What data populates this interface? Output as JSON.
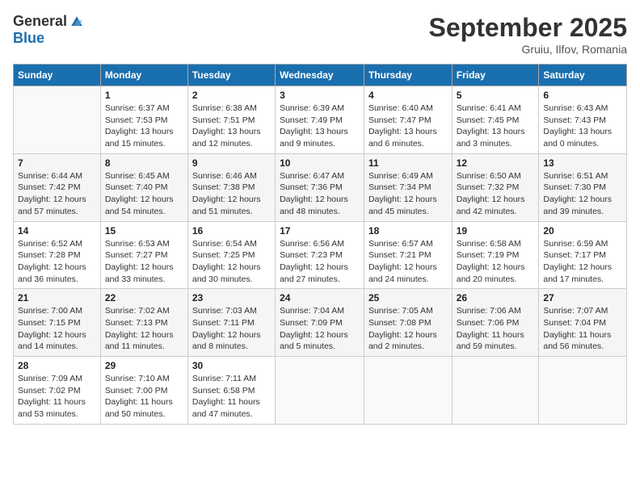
{
  "header": {
    "logo_general": "General",
    "logo_blue": "Blue",
    "month": "September 2025",
    "location": "Gruiu, Ilfov, Romania"
  },
  "weekdays": [
    "Sunday",
    "Monday",
    "Tuesday",
    "Wednesday",
    "Thursday",
    "Friday",
    "Saturday"
  ],
  "weeks": [
    [
      {
        "num": "",
        "sunrise": "",
        "sunset": "",
        "daylight": "",
        "empty": true
      },
      {
        "num": "1",
        "sunrise": "Sunrise: 6:37 AM",
        "sunset": "Sunset: 7:53 PM",
        "daylight": "Daylight: 13 hours and 15 minutes."
      },
      {
        "num": "2",
        "sunrise": "Sunrise: 6:38 AM",
        "sunset": "Sunset: 7:51 PM",
        "daylight": "Daylight: 13 hours and 12 minutes."
      },
      {
        "num": "3",
        "sunrise": "Sunrise: 6:39 AM",
        "sunset": "Sunset: 7:49 PM",
        "daylight": "Daylight: 13 hours and 9 minutes."
      },
      {
        "num": "4",
        "sunrise": "Sunrise: 6:40 AM",
        "sunset": "Sunset: 7:47 PM",
        "daylight": "Daylight: 13 hours and 6 minutes."
      },
      {
        "num": "5",
        "sunrise": "Sunrise: 6:41 AM",
        "sunset": "Sunset: 7:45 PM",
        "daylight": "Daylight: 13 hours and 3 minutes."
      },
      {
        "num": "6",
        "sunrise": "Sunrise: 6:43 AM",
        "sunset": "Sunset: 7:43 PM",
        "daylight": "Daylight: 13 hours and 0 minutes."
      }
    ],
    [
      {
        "num": "7",
        "sunrise": "Sunrise: 6:44 AM",
        "sunset": "Sunset: 7:42 PM",
        "daylight": "Daylight: 12 hours and 57 minutes."
      },
      {
        "num": "8",
        "sunrise": "Sunrise: 6:45 AM",
        "sunset": "Sunset: 7:40 PM",
        "daylight": "Daylight: 12 hours and 54 minutes."
      },
      {
        "num": "9",
        "sunrise": "Sunrise: 6:46 AM",
        "sunset": "Sunset: 7:38 PM",
        "daylight": "Daylight: 12 hours and 51 minutes."
      },
      {
        "num": "10",
        "sunrise": "Sunrise: 6:47 AM",
        "sunset": "Sunset: 7:36 PM",
        "daylight": "Daylight: 12 hours and 48 minutes."
      },
      {
        "num": "11",
        "sunrise": "Sunrise: 6:49 AM",
        "sunset": "Sunset: 7:34 PM",
        "daylight": "Daylight: 12 hours and 45 minutes."
      },
      {
        "num": "12",
        "sunrise": "Sunrise: 6:50 AM",
        "sunset": "Sunset: 7:32 PM",
        "daylight": "Daylight: 12 hours and 42 minutes."
      },
      {
        "num": "13",
        "sunrise": "Sunrise: 6:51 AM",
        "sunset": "Sunset: 7:30 PM",
        "daylight": "Daylight: 12 hours and 39 minutes."
      }
    ],
    [
      {
        "num": "14",
        "sunrise": "Sunrise: 6:52 AM",
        "sunset": "Sunset: 7:28 PM",
        "daylight": "Daylight: 12 hours and 36 minutes."
      },
      {
        "num": "15",
        "sunrise": "Sunrise: 6:53 AM",
        "sunset": "Sunset: 7:27 PM",
        "daylight": "Daylight: 12 hours and 33 minutes."
      },
      {
        "num": "16",
        "sunrise": "Sunrise: 6:54 AM",
        "sunset": "Sunset: 7:25 PM",
        "daylight": "Daylight: 12 hours and 30 minutes."
      },
      {
        "num": "17",
        "sunrise": "Sunrise: 6:56 AM",
        "sunset": "Sunset: 7:23 PM",
        "daylight": "Daylight: 12 hours and 27 minutes."
      },
      {
        "num": "18",
        "sunrise": "Sunrise: 6:57 AM",
        "sunset": "Sunset: 7:21 PM",
        "daylight": "Daylight: 12 hours and 24 minutes."
      },
      {
        "num": "19",
        "sunrise": "Sunrise: 6:58 AM",
        "sunset": "Sunset: 7:19 PM",
        "daylight": "Daylight: 12 hours and 20 minutes."
      },
      {
        "num": "20",
        "sunrise": "Sunrise: 6:59 AM",
        "sunset": "Sunset: 7:17 PM",
        "daylight": "Daylight: 12 hours and 17 minutes."
      }
    ],
    [
      {
        "num": "21",
        "sunrise": "Sunrise: 7:00 AM",
        "sunset": "Sunset: 7:15 PM",
        "daylight": "Daylight: 12 hours and 14 minutes."
      },
      {
        "num": "22",
        "sunrise": "Sunrise: 7:02 AM",
        "sunset": "Sunset: 7:13 PM",
        "daylight": "Daylight: 12 hours and 11 minutes."
      },
      {
        "num": "23",
        "sunrise": "Sunrise: 7:03 AM",
        "sunset": "Sunset: 7:11 PM",
        "daylight": "Daylight: 12 hours and 8 minutes."
      },
      {
        "num": "24",
        "sunrise": "Sunrise: 7:04 AM",
        "sunset": "Sunset: 7:09 PM",
        "daylight": "Daylight: 12 hours and 5 minutes."
      },
      {
        "num": "25",
        "sunrise": "Sunrise: 7:05 AM",
        "sunset": "Sunset: 7:08 PM",
        "daylight": "Daylight: 12 hours and 2 minutes."
      },
      {
        "num": "26",
        "sunrise": "Sunrise: 7:06 AM",
        "sunset": "Sunset: 7:06 PM",
        "daylight": "Daylight: 11 hours and 59 minutes."
      },
      {
        "num": "27",
        "sunrise": "Sunrise: 7:07 AM",
        "sunset": "Sunset: 7:04 PM",
        "daylight": "Daylight: 11 hours and 56 minutes."
      }
    ],
    [
      {
        "num": "28",
        "sunrise": "Sunrise: 7:09 AM",
        "sunset": "Sunset: 7:02 PM",
        "daylight": "Daylight: 11 hours and 53 minutes."
      },
      {
        "num": "29",
        "sunrise": "Sunrise: 7:10 AM",
        "sunset": "Sunset: 7:00 PM",
        "daylight": "Daylight: 11 hours and 50 minutes."
      },
      {
        "num": "30",
        "sunrise": "Sunrise: 7:11 AM",
        "sunset": "Sunset: 6:58 PM",
        "daylight": "Daylight: 11 hours and 47 minutes."
      },
      {
        "num": "",
        "sunrise": "",
        "sunset": "",
        "daylight": "",
        "empty": true
      },
      {
        "num": "",
        "sunrise": "",
        "sunset": "",
        "daylight": "",
        "empty": true
      },
      {
        "num": "",
        "sunrise": "",
        "sunset": "",
        "daylight": "",
        "empty": true
      },
      {
        "num": "",
        "sunrise": "",
        "sunset": "",
        "daylight": "",
        "empty": true
      }
    ]
  ]
}
